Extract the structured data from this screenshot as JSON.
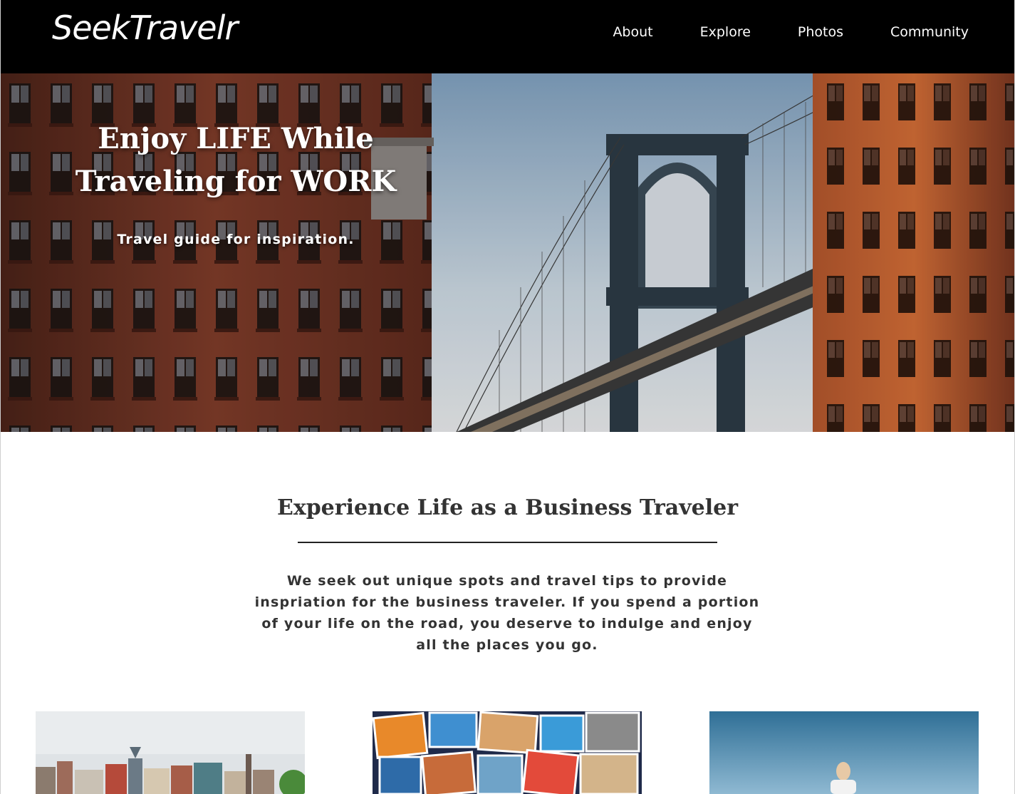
{
  "header": {
    "logo": "SeekTravelr",
    "nav": [
      {
        "label": "About"
      },
      {
        "label": "Explore"
      },
      {
        "label": "Photos"
      },
      {
        "label": "Community"
      }
    ]
  },
  "hero": {
    "title_line1": "Enjoy LIFE While",
    "title_line2": "Traveling for WORK",
    "subtitle": "Travel guide for inspiration."
  },
  "intro": {
    "heading": "Experience Life as a Business Traveler",
    "body": "We seek out unique spots and travel tips to provide inspriation for the business traveler. If you spend a portion of your life on the road, you deserve to indulge and enjoy all the places you go."
  },
  "cards": [
    {
      "image": "city-waterfront-photo"
    },
    {
      "image": "travel-photo-collage"
    },
    {
      "image": "traveler-by-sea-photo"
    }
  ],
  "colors": {
    "header_bg": "#000000",
    "text_dark": "#333333",
    "brick": "#7a3b2a",
    "sky": "#9fb9cf"
  }
}
